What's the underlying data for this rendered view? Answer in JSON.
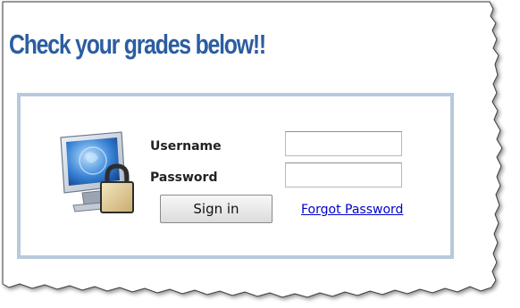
{
  "page": {
    "title": "Check your grades below!!"
  },
  "login": {
    "username_label": "Username",
    "password_label": "Password",
    "username_value": "",
    "password_value": "",
    "sign_in_label": "Sign in",
    "forgot_password_label": "Forgot Password"
  },
  "icons": {
    "login_icon": "computer-monitor-with-padlock-icon"
  },
  "colors": {
    "title": "#2b5da1",
    "box_border": "#b7c9dc",
    "link": "#0000cc"
  }
}
